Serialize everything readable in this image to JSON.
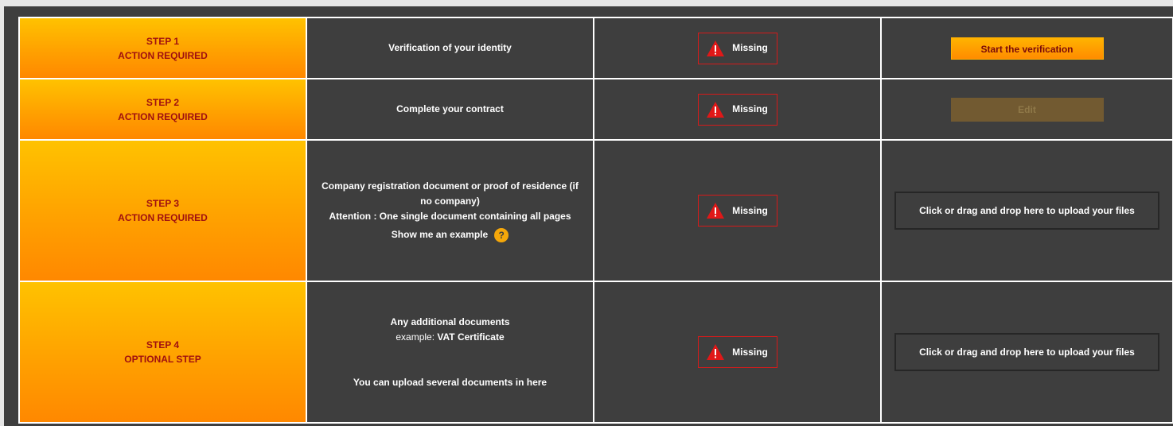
{
  "colors": {
    "step_gradient_top": "#ffc200",
    "step_gradient_bottom": "#ff8800",
    "step_text": "#a01010",
    "panel_bg": "#3e3e3e",
    "missing_border": "#d61a1a",
    "warning_icon": "#e01818",
    "start_button": "#ff9d00",
    "edit_button_disabled": "#725a31",
    "help_icon": "#f5a70a"
  },
  "steps": [
    {
      "step_label": "STEP 1",
      "state_label": "ACTION REQUIRED",
      "description": "Verification of your identity",
      "status": "Missing",
      "status_icon": "warning-triangle-icon",
      "action": {
        "type": "button",
        "label": "Start the verification"
      }
    },
    {
      "step_label": "STEP 2",
      "state_label": "ACTION REQUIRED",
      "description": "Complete your contract",
      "status": "Missing",
      "status_icon": "warning-triangle-icon",
      "action": {
        "type": "button-disabled",
        "label": "Edit"
      }
    },
    {
      "step_label": "STEP 3",
      "state_label": "ACTION REQUIRED",
      "description_line1": "Company registration document or proof of residence (if no company)",
      "description_line2": "Attention : One single document containing all pages",
      "example_link": "Show me an example",
      "help_icon": "?",
      "status": "Missing",
      "status_icon": "warning-triangle-icon",
      "action": {
        "type": "upload",
        "label": "Click or drag and drop here to upload your files"
      }
    },
    {
      "step_label": "STEP 4",
      "state_label": "OPTIONAL STEP",
      "description_line1": "Any additional documents",
      "example_prefix": "example: ",
      "example_value": "VAT Certificate",
      "description_note": "You can upload several documents in here",
      "status": "Missing",
      "status_icon": "warning-triangle-icon",
      "action": {
        "type": "upload",
        "label": "Click or drag and drop here to upload your files"
      }
    }
  ]
}
